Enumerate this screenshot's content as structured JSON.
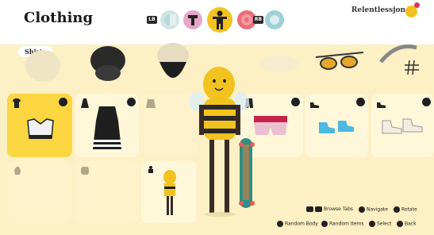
{
  "header": {
    "title": "Clothing",
    "username": "Relentlessjon",
    "lb_label": "LB",
    "rb_label": "RB"
  },
  "tabs": [
    {
      "name": "body-tab",
      "color": "#cfe5e4"
    },
    {
      "name": "head-tab",
      "color": "#e6a6c7"
    },
    {
      "name": "clothing-tab",
      "color": "#f2c21f"
    },
    {
      "name": "gear-tab",
      "color": "#e96d78"
    },
    {
      "name": "board-tab",
      "color": "#9fd1d6"
    }
  ],
  "category_label": "Shirts",
  "hints": {
    "browse_tabs": "Browse Tabs",
    "navigate": "Navigate",
    "rotate": "Rotate",
    "random_body": "Random Body",
    "random_items": "Random Items",
    "select": "Select",
    "back": "Back"
  },
  "colors": {
    "accent": "#f2c21f",
    "background": "#fdf0c4",
    "selected_tile": "#fbd640"
  }
}
